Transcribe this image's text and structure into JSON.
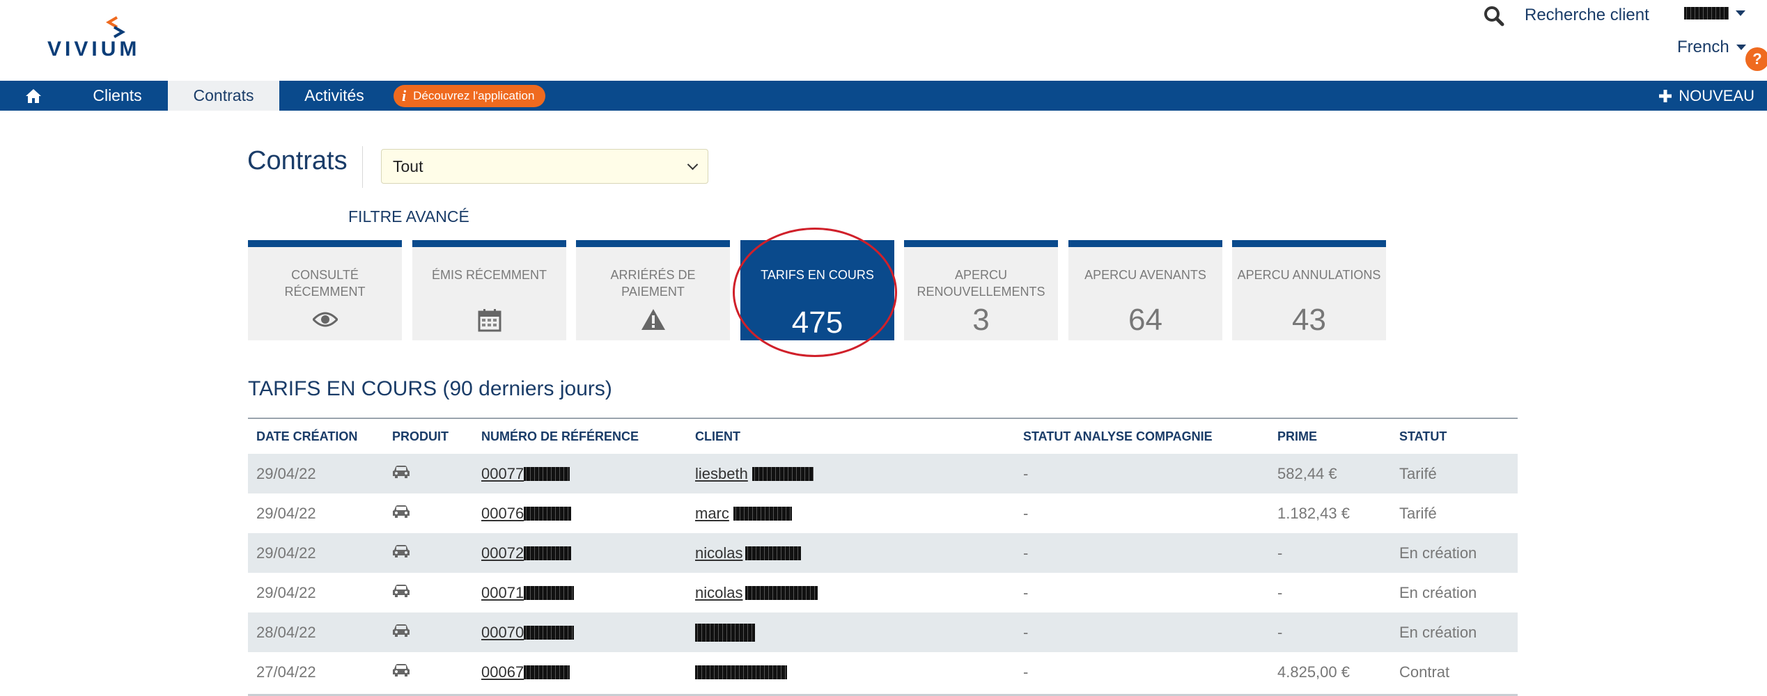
{
  "brand": {
    "name": "VIVIUM",
    "colors": {
      "primary": "#0a4a8c",
      "accent": "#ef6a1f"
    }
  },
  "header": {
    "search_label": "Recherche client",
    "search_icon": "search-icon",
    "language": "French",
    "help_label": "?"
  },
  "nav": {
    "home_icon": "home-icon",
    "items": [
      {
        "label": "Clients",
        "active": false
      },
      {
        "label": "Contrats",
        "active": true
      },
      {
        "label": "Activités",
        "active": false
      }
    ],
    "discover": {
      "icon": "i",
      "label": "Découvrez l'application"
    },
    "new_label": "NOUVEAU"
  },
  "page": {
    "title": "Contrats",
    "filter_value": "Tout",
    "advanced_filter": "FILTRE AVANCÉ"
  },
  "tiles": [
    {
      "label": "CONSULTÉ RÉCEMMENT",
      "icon": "eye-icon"
    },
    {
      "label": "ÉMIS RÉCEMMENT",
      "icon": "calendar-icon"
    },
    {
      "label": "ARRIÉRÉS DE PAIEMENT",
      "icon": "warning-icon"
    },
    {
      "label": "TARIFS EN COURS",
      "value": "475",
      "active": true
    },
    {
      "label": "APERCU RENOUVELLEMENTS",
      "value": "3"
    },
    {
      "label": "APERCU AVENANTS",
      "value": "64"
    },
    {
      "label": "APERCU ANNULATIONS",
      "value": "43"
    }
  ],
  "section": {
    "title": "TARIFS EN COURS (90 derniers jours)",
    "columns": [
      "DATE CRÉATION",
      "PRODUIT",
      "NUMÉRO DE RÉFÉRENCE",
      "CLIENT",
      "STATUT ANALYSE COMPAGNIE",
      "PRIME",
      "STATUT"
    ],
    "rows": [
      {
        "date": "29/04/22",
        "product_icon": "car-icon",
        "ref": "00077",
        "client": "liesbeth",
        "analysis": "-",
        "premium": "582,44 €",
        "status": "Tarifé"
      },
      {
        "date": "29/04/22",
        "product_icon": "car-icon",
        "ref": "00076",
        "client": "marc",
        "analysis": "-",
        "premium": "1.182,43 €",
        "status": "Tarifé"
      },
      {
        "date": "29/04/22",
        "product_icon": "car-icon",
        "ref": "00072",
        "client": "nicolas",
        "analysis": "-",
        "premium": "-",
        "status": "En création"
      },
      {
        "date": "29/04/22",
        "product_icon": "car-icon",
        "ref": "00071",
        "client": "nicolas",
        "analysis": "-",
        "premium": "-",
        "status": "En création"
      },
      {
        "date": "28/04/22",
        "product_icon": "car-icon",
        "ref": "00070",
        "client": "",
        "analysis": "-",
        "premium": "-",
        "status": "En création"
      },
      {
        "date": "27/04/22",
        "product_icon": "car-icon",
        "ref": "00067",
        "client": "",
        "analysis": "-",
        "premium": "4.825,00 €",
        "status": "Contrat"
      }
    ]
  }
}
